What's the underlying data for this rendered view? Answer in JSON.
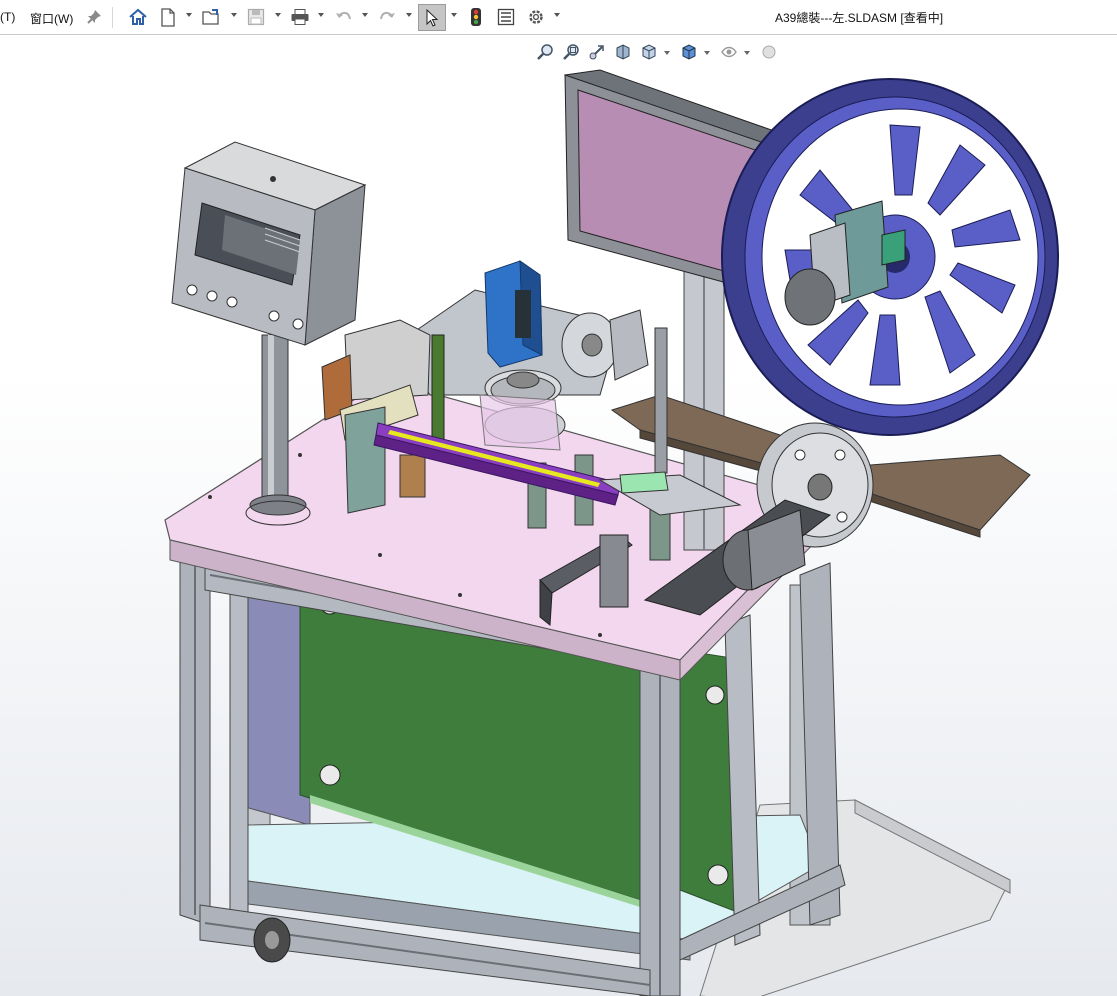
{
  "menubar": {
    "tools_menu": "(T)",
    "window_menu": "窗口(W)",
    "icons": [
      "pin-icon",
      "home-icon",
      "new-document-icon",
      "open-folder-icon",
      "save-icon",
      "print-icon",
      "undo-icon",
      "redo-icon",
      "select-pointer-icon",
      "traffic-light-icon",
      "file-properties-icon",
      "options-gear-icon"
    ]
  },
  "document": {
    "title": "A39總裝---左.SLDASM [查看中]"
  },
  "heads_up_toolbar": {
    "icons": [
      "zoom-to-fit-icon",
      "zoom-to-area-icon",
      "previous-view-icon",
      "section-view-icon",
      "view-orientation-icon",
      "display-style-icon",
      "hide-show-items-icon",
      "appearance-icon"
    ]
  },
  "colors": {
    "table_top": "#f2d7ef",
    "reel": "#3c3f8e",
    "green_panel": "#3e7d3c",
    "frame": "#b8bcc4",
    "monitor_screen": "#b88db3",
    "blue_cylinder": "#2f73c9"
  }
}
